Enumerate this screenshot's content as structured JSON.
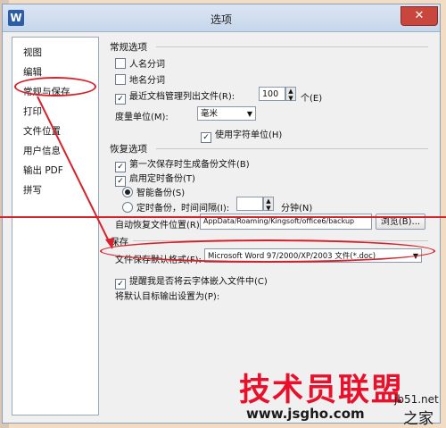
{
  "window": {
    "title": "选项",
    "app_icon": "W",
    "close_label": "✕"
  },
  "sidebar": {
    "items": [
      {
        "label": "视图"
      },
      {
        "label": "编辑"
      },
      {
        "label": "常规与保存"
      },
      {
        "label": "打印"
      },
      {
        "label": "文件位置"
      },
      {
        "label": "用户信息"
      },
      {
        "label": "输出 PDF"
      },
      {
        "label": "拼写"
      }
    ],
    "selected": "常规与保存"
  },
  "general": {
    "title": "常规选项",
    "person_name": {
      "label": "人名分词",
      "checked": false
    },
    "place_name": {
      "label": "地名分词",
      "checked": false
    },
    "recent_docs": {
      "label": "最近文档管理列出文件(R):",
      "checked": true,
      "value": "100",
      "unit": "个(E)"
    },
    "measure_label": "度量单位(M):",
    "measure_value": "毫米",
    "char_unit": {
      "label": "使用字符单位(H)",
      "checked": true
    }
  },
  "recovery": {
    "title": "恢复选项",
    "first_backup": {
      "label": "第一次保存时生成备份文件(B)",
      "checked": true
    },
    "timed_backup": {
      "label": "启用定时备份(T)",
      "checked": true
    },
    "smart_backup": {
      "label": "智能备份(S)",
      "selected": true
    },
    "interval_backup": {
      "label": "定时备份，时间间隔(I):",
      "selected": false,
      "unit": "分钟(N)",
      "value": ""
    },
    "location_label": "自动恢复文件位置(R):",
    "location_value": "AppData/Roaming/Kingsoft/office6/backup",
    "browse_label": "浏览(B)..."
  },
  "save": {
    "title": "保存",
    "format_label": "文件保存默认格式(F):",
    "format_value": "Microsoft Word 97/2000/XP/2003 文件(*.doc)",
    "embed_font": {
      "label": "提醒我是否将云字体嵌入文件中(C)",
      "checked": true
    },
    "default_output_label": "将默认目标输出设置为(P):"
  },
  "watermark": {
    "brand": "技术员联盟",
    "url": "www.jsgho.com",
    "jb51": "jb51.net",
    "home": "之家"
  },
  "colors": {
    "annotation_red": "#d8202a",
    "title_bar": "#c6d6ea",
    "close_button": "#c9463d"
  }
}
